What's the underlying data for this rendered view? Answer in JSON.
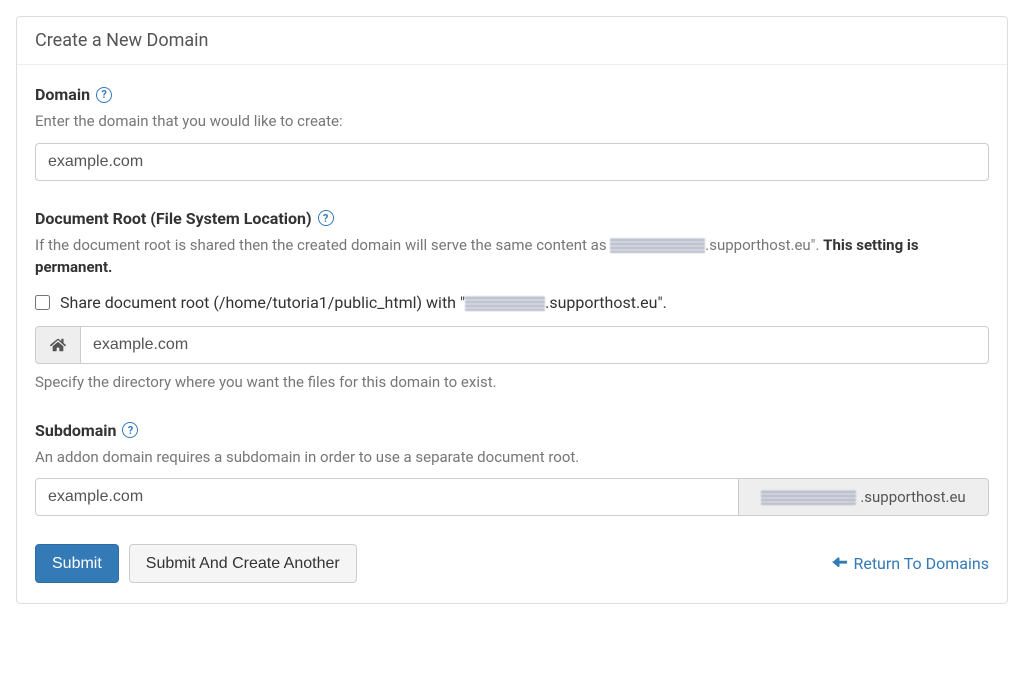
{
  "panel": {
    "title": "Create a New Domain"
  },
  "domain": {
    "label": "Domain",
    "help": "Enter the domain that you would like to create:",
    "value": "example.com"
  },
  "docroot": {
    "label": "Document Root (File System Location)",
    "help_prefix": "If the document root is shared then the created domain will serve the same content as ",
    "help_suffix": ".supporthost.eu\". ",
    "help_bold": "This setting is permanent.",
    "checkbox_prefix": "Share document root (/home/tutoria1/public_html) with \"",
    "checkbox_suffix": ".supporthost.eu\".",
    "value": "example.com",
    "below": "Specify the directory where you want the files for this domain to exist."
  },
  "subdomain": {
    "label": "Subdomain",
    "help": "An addon domain requires a subdomain in order to use a separate document root.",
    "value": "example.com",
    "suffix": ".supporthost.eu"
  },
  "buttons": {
    "submit": "Submit",
    "submit_another": "Submit And Create Another",
    "return": "Return To Domains"
  }
}
